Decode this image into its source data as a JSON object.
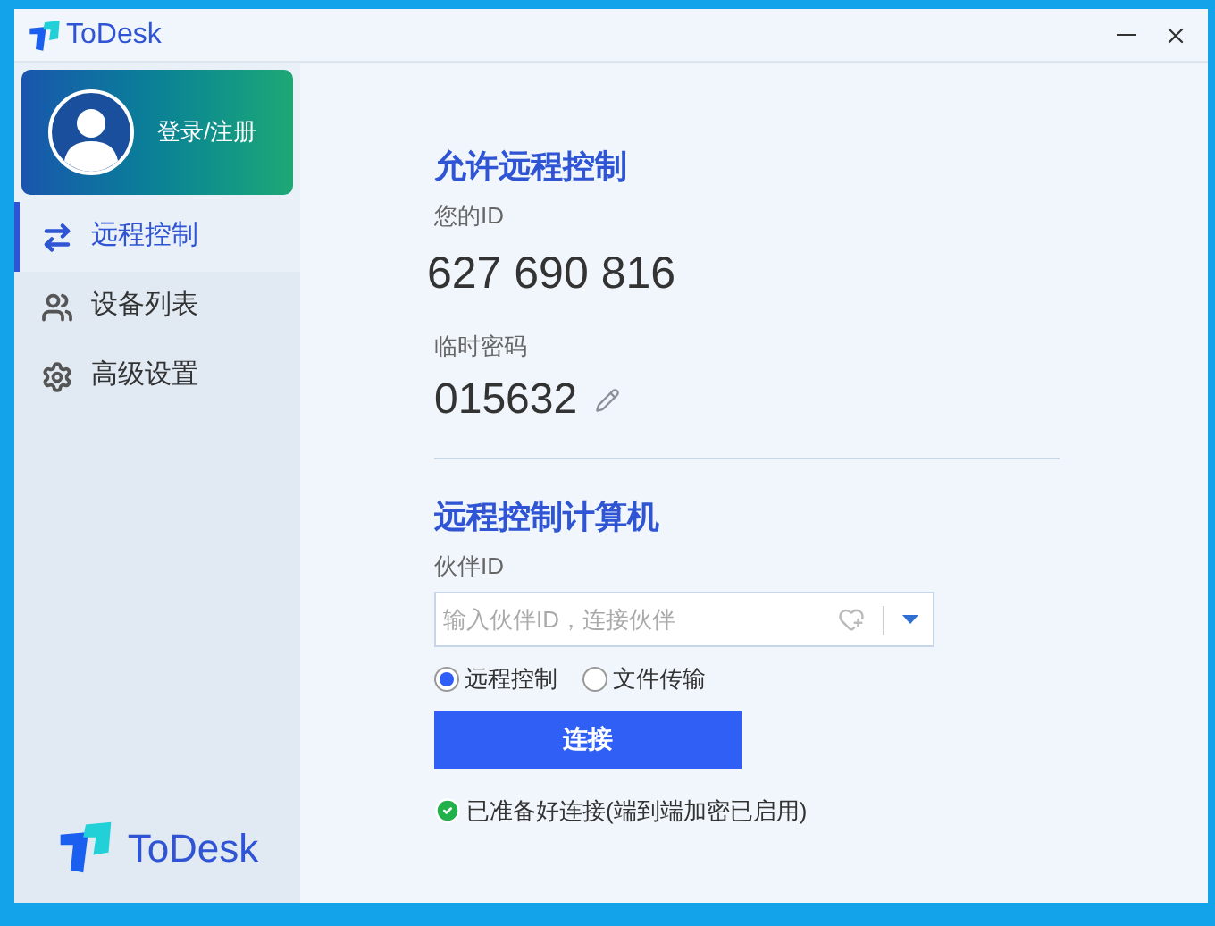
{
  "window": {
    "title": "ToDesk"
  },
  "profile": {
    "label": "登录/注册"
  },
  "sidebar": {
    "items": [
      {
        "label": "远程控制",
        "kind": "arrows",
        "selected": true
      },
      {
        "label": "设备列表",
        "kind": "users",
        "selected": false
      },
      {
        "label": "高级设置",
        "kind": "gear",
        "selected": false
      }
    ],
    "brand": "ToDesk"
  },
  "allow": {
    "title": "允许远程控制",
    "id_label": "您的ID",
    "id": "627 690 816",
    "password_label": "临时密码",
    "password": "015632"
  },
  "connect": {
    "title": "远程控制计算机",
    "partner_label": "伙伴ID",
    "field": {
      "placeholder": "输入伙伴ID，连接伙伴"
    },
    "modes": [
      {
        "label": "远程控制",
        "selected": true
      },
      {
        "label": "文件传输",
        "selected": false
      }
    ],
    "button": "连接",
    "status": "已准备好连接(端到端加密已启用)"
  }
}
